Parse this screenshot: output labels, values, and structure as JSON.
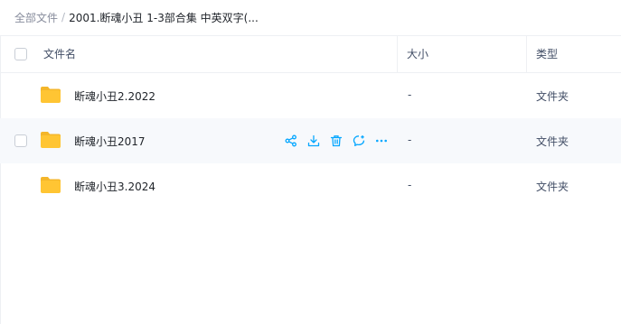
{
  "breadcrumb": {
    "root": "全部文件",
    "separator": "/",
    "current": "2001.断魂小丑 1-3部合集 中英双字(..."
  },
  "table": {
    "headers": {
      "name": "文件名",
      "size": "大小",
      "type": "类型"
    },
    "rows": [
      {
        "name": "断魂小丑2.2022",
        "size": "-",
        "type": "文件夹",
        "icon": "folder-icon",
        "hovered": false
      },
      {
        "name": "断魂小丑2017",
        "size": "-",
        "type": "文件夹",
        "icon": "folder-icon",
        "hovered": true
      },
      {
        "name": "断魂小丑3.2024",
        "size": "-",
        "type": "文件夹",
        "icon": "folder-icon",
        "hovered": false
      }
    ],
    "row_actions": [
      "share-icon",
      "download-icon",
      "delete-icon",
      "comment-icon",
      "more-icon"
    ]
  },
  "colors": {
    "accent": "#06a7ff",
    "folder": "#ffc533",
    "hover_bg": "#f7f9fc"
  }
}
